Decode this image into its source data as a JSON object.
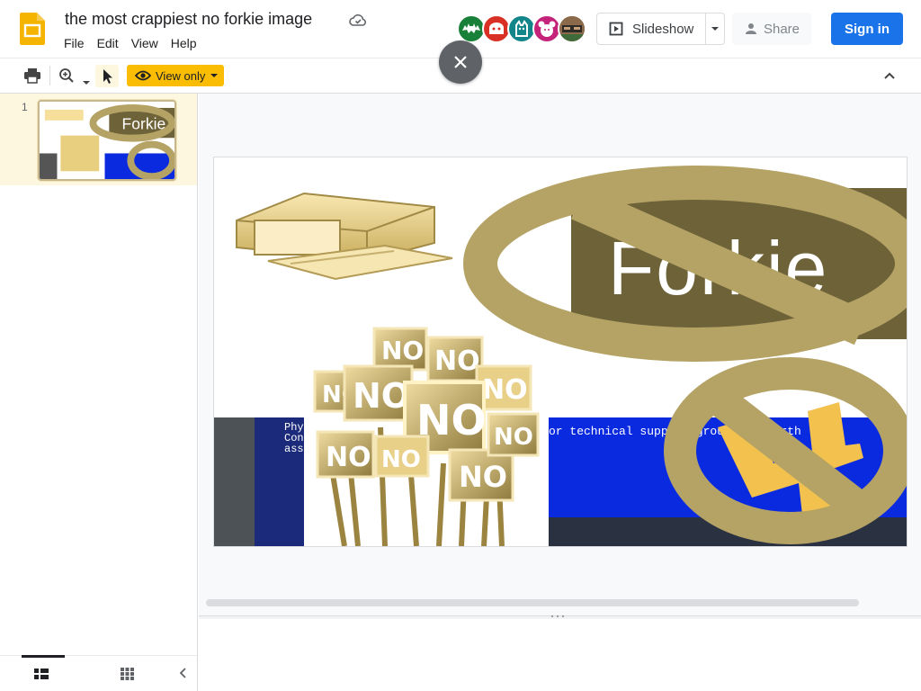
{
  "document": {
    "title": "the most crappiest no forkie image"
  },
  "menu": [
    "File",
    "Edit",
    "View",
    "Help"
  ],
  "collaborators": [
    {
      "name": "anonymous-batman",
      "color": "#188038",
      "icon": "batman-icon"
    },
    {
      "name": "anonymous-ghost",
      "color": "#d93025",
      "icon": "ghost-icon"
    },
    {
      "name": "anonymous-cat",
      "color": "#12858a",
      "icon": "cat-icon"
    },
    {
      "name": "anonymous-bear",
      "color": "#c5227a",
      "icon": "bear-icon"
    },
    {
      "name": "user-photo",
      "color": "#6b4a33",
      "icon": "avatar-photo"
    }
  ],
  "buttons": {
    "slideshow": "Slideshow",
    "share": "Share",
    "sign_in": "Sign in",
    "view_only": "View only"
  },
  "filmstrip": {
    "slides": [
      {
        "number": "1"
      }
    ]
  },
  "slide": {
    "forkie_text": "Forkie",
    "no_sign_text": "NO",
    "bsod_text": "or technical support group for furth",
    "bsod_left_text": [
      "Phy",
      "Con",
      "ass"
    ]
  },
  "colors": {
    "accent": "#1a73e8",
    "view_only_bg": "#fbbc04",
    "slides_logo": "#f4b400",
    "tan": "#b5a366",
    "bsod_blue": "#0a2ae0"
  }
}
